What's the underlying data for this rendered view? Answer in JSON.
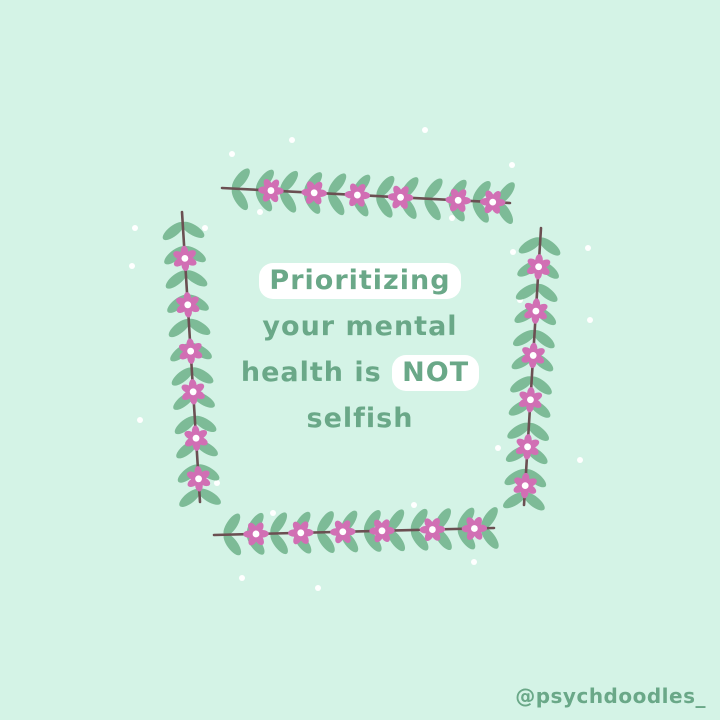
{
  "colors": {
    "background": "#d4f3e6",
    "text": "#6aa888",
    "highlight": "#ffffff",
    "leaf": "#7dbb97",
    "stem": "#6b4f52",
    "flower": "#d16fb4",
    "flower_center": "#ffffff"
  },
  "message": {
    "line1": "Prioritizing",
    "line2": "your mental",
    "line3_start": "health is",
    "line3_emphasis": "NOT",
    "line4": "selfish"
  },
  "credit": "@psychdoodles_",
  "illustration": {
    "type": "floral wreath",
    "icon": "flower-wreath-icon"
  }
}
